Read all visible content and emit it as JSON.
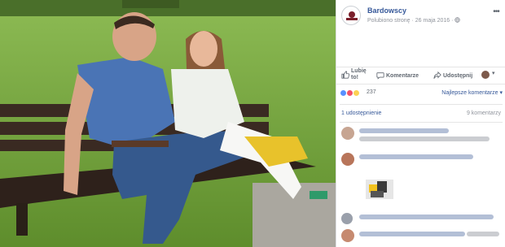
{
  "post": {
    "page_name": "Bardowscy",
    "page_logo_text": "BARDOWSCY",
    "meta": "Polubiono stronę · 26 maja 2016 · ",
    "globe_icon": "globe-icon"
  },
  "actions": {
    "like_line1": "Lubię",
    "like_line2": "to!",
    "comment": "Komentarze",
    "share": "Udostępnij",
    "share_dropdown_icon": "chevron-down-icon"
  },
  "reactions": {
    "icons": [
      "like",
      "love",
      "haha"
    ],
    "count": "237",
    "sort_label": "Najlepsze komentarze ▾"
  },
  "stats": {
    "shares": "1 udostępnienie",
    "comments": "9 komentarzy"
  },
  "colors": {
    "link": "#365899",
    "meta": "#90949c",
    "action": "#606770",
    "like_blue": "#5890ff",
    "love_red": "#f25268",
    "haha_yellow": "#fcd153"
  }
}
